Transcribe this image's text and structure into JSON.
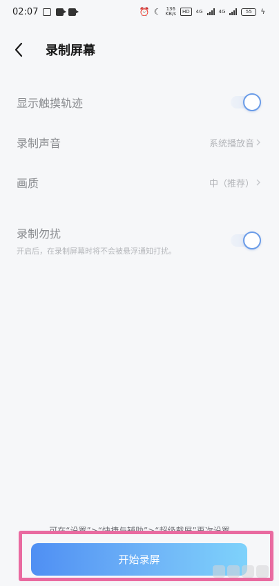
{
  "status_bar": {
    "time": "02:07",
    "net_speed_top": "136",
    "net_speed_bottom": "KB/s",
    "hd_badge": "HD",
    "network_1": "4G",
    "network_2": "4G",
    "battery": "55"
  },
  "header": {
    "title": "录制屏幕"
  },
  "settings": {
    "show_touch": {
      "label": "显示触摸轨迹",
      "enabled": true
    },
    "sound": {
      "label": "录制声音",
      "value": "系统播放音"
    },
    "quality": {
      "label": "画质",
      "value": "中（推荐）"
    },
    "dnd": {
      "label": "录制勿扰",
      "description": "开启后，在录制屏幕时将不会被悬浮通知打扰。",
      "enabled": true
    }
  },
  "footer": {
    "hint": "可在“设置”>“快捷与辅助”>“超级截屏”再次设置",
    "start_button": "开始录屏"
  },
  "colors": {
    "accent": "#6a9ce8",
    "button_start": "#4f8ff3",
    "button_end": "#7ed2fb",
    "highlight": "#e96aa0"
  }
}
